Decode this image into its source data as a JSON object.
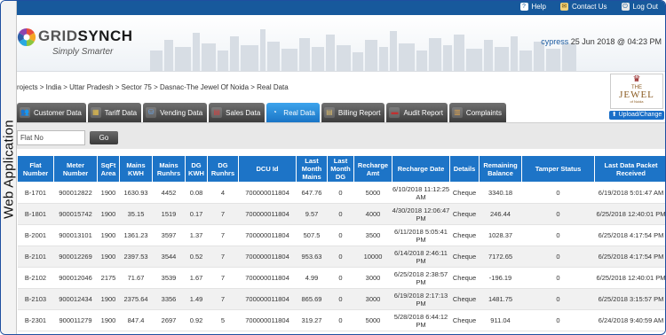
{
  "side_label": "Web Application",
  "topbar": {
    "help": "Help",
    "contact": "Contact Us",
    "logout": "Log Out"
  },
  "brand": {
    "name_light": "GRID",
    "name_bold": "SYNCH",
    "tagline": "Simply Smarter"
  },
  "user": {
    "name": "cypress",
    "datetime": "25 Jun 2018 @ 04:23 PM"
  },
  "breadcrumb": "rojects > India > Uttar Pradesh > Sector 75 > Dasnac-The Jewel Of Noida > Real Data",
  "project_logo": {
    "the": "THE",
    "name": "JEWEL",
    "sub": "of Noida"
  },
  "upload_label": "Upload/Change",
  "tabs": [
    {
      "label": "Customer Data",
      "icon": "customer-icon"
    },
    {
      "label": "Tariff Data",
      "icon": "tariff-icon"
    },
    {
      "label": "Vending Data",
      "icon": "vending-icon"
    },
    {
      "label": "Sales Data",
      "icon": "sales-icon"
    },
    {
      "label": "Real Data",
      "icon": "realdata-icon",
      "active": true
    },
    {
      "label": "Billing Report",
      "icon": "billing-icon"
    },
    {
      "label": "Audit Report",
      "icon": "audit-icon"
    },
    {
      "label": "Complaints",
      "icon": "complaints-icon"
    }
  ],
  "filter": {
    "placeholder": "Flat No",
    "go_label": "Go"
  },
  "table": {
    "headers": [
      "Flat Number",
      "Meter Number",
      "SqFt Area",
      "Mains KWH",
      "Mains Runhrs",
      "DG KWH",
      "DG Runhrs",
      "DCU Id",
      "Last Month Mains",
      "Last Month DG",
      "Recharge Amt",
      "Recharge Date",
      "Details",
      "Remaining Balance",
      "Tamper Status",
      "Last Data Packet Received"
    ],
    "rows": [
      [
        "B-1701",
        "900012822",
        "1900",
        "1630.93",
        "4452",
        "0.08",
        "4",
        "700000011804",
        "647.76",
        "0",
        "5000",
        "6/10/2018 11:12:25 AM",
        "Cheque",
        "3340.18",
        "0",
        "6/19/2018 5:01:47 AM"
      ],
      [
        "B-1801",
        "900015742",
        "1900",
        "35.15",
        "1519",
        "0.17",
        "7",
        "700000011804",
        "9.57",
        "0",
        "4000",
        "4/30/2018 12:06:47 PM",
        "Cheque",
        "246.44",
        "0",
        "6/25/2018 12:40:01 PM"
      ],
      [
        "B-2001",
        "900013101",
        "1900",
        "1361.23",
        "3597",
        "1.37",
        "7",
        "700000011804",
        "507.5",
        "0",
        "3500",
        "6/11/2018 5:05:41 PM",
        "Cheque",
        "1028.37",
        "0",
        "6/25/2018 4:17:54 PM"
      ],
      [
        "B-2101",
        "900012269",
        "1900",
        "2397.53",
        "3544",
        "0.52",
        "7",
        "700000011804",
        "953.63",
        "0",
        "10000",
        "6/14/2018 2:46:11 PM",
        "Cheque",
        "7172.65",
        "0",
        "6/25/2018 4:17:54 PM"
      ],
      [
        "B-2102",
        "900012046",
        "2175",
        "71.67",
        "3539",
        "1.67",
        "7",
        "700000011804",
        "4.99",
        "0",
        "3000",
        "6/25/2018 2:38:57 PM",
        "Cheque",
        "-196.19",
        "0",
        "6/25/2018 12:40:01 PM"
      ],
      [
        "B-2103",
        "900012434",
        "1900",
        "2375.64",
        "3356",
        "1.49",
        "7",
        "700000011804",
        "865.69",
        "0",
        "3000",
        "6/19/2018 2:17:13 PM",
        "Cheque",
        "1481.75",
        "0",
        "6/25/2018 3:15:57 PM"
      ],
      [
        "B-2301",
        "900011279",
        "1900",
        "847.4",
        "2697",
        "0.92",
        "5",
        "700000011804",
        "319.27",
        "0",
        "5000",
        "5/28/2018 6:44:12 PM",
        "Cheque",
        "911.04",
        "0",
        "6/24/2018 9:40:59 AM"
      ]
    ]
  },
  "colors": {
    "topbar": "#17599c",
    "table_header": "#1d74c7",
    "tab": "#4a4a4a",
    "tab_active": "#2b8ad6"
  }
}
